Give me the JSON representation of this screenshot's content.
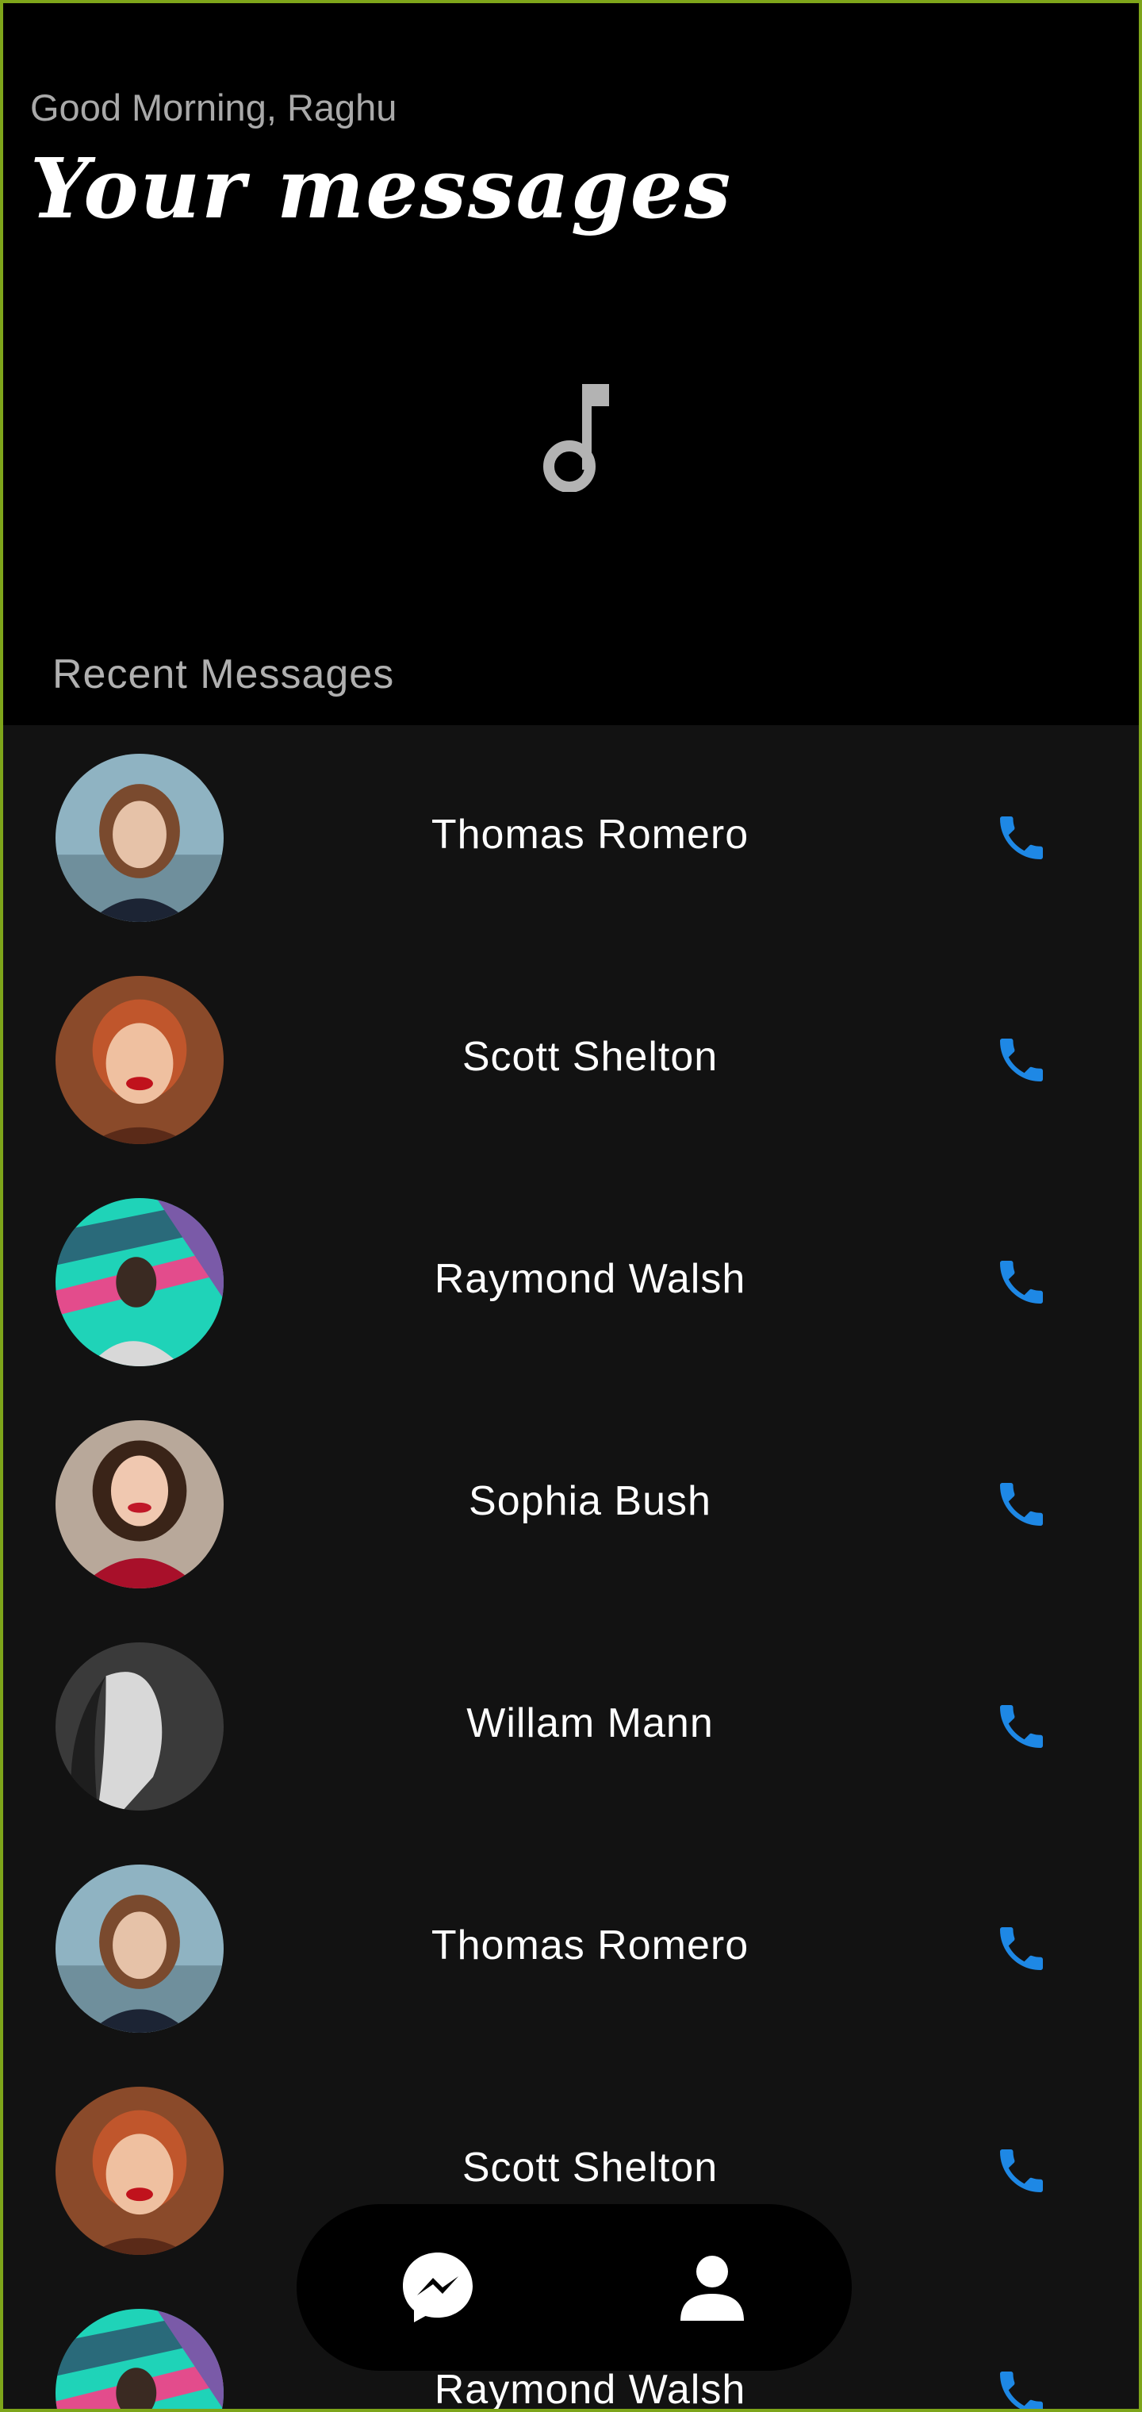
{
  "header": {
    "greeting": "Good Morning, Raghu",
    "title": "Your messages",
    "center_icon": "music-note-icon",
    "section_label": "Recent Messages"
  },
  "colors": {
    "background": "#000000",
    "list_background": "#121212",
    "accent_phone": "#1e88e5",
    "muted_text": "#a9a9a9",
    "frame_border": "#7ea51a"
  },
  "contacts": [
    {
      "name": "Thomas Romero",
      "avatar": "avatar-photo",
      "action_icon": "phone-icon"
    },
    {
      "name": "Scott Shelton",
      "avatar": "avatar-photo",
      "action_icon": "phone-icon"
    },
    {
      "name": "Raymond Walsh",
      "avatar": "avatar-photo",
      "action_icon": "phone-icon"
    },
    {
      "name": "Sophia Bush",
      "avatar": "avatar-photo",
      "action_icon": "phone-icon"
    },
    {
      "name": "Willam Mann",
      "avatar": "avatar-photo",
      "action_icon": "phone-icon"
    },
    {
      "name": "Thomas Romero",
      "avatar": "avatar-photo",
      "action_icon": "phone-icon"
    },
    {
      "name": "Scott Shelton",
      "avatar": "avatar-photo",
      "action_icon": "phone-icon"
    },
    {
      "name": "Raymond Walsh",
      "avatar": "avatar-photo",
      "action_icon": "phone-icon"
    }
  ],
  "bottom_nav": {
    "items": [
      {
        "icon": "messenger-icon"
      },
      {
        "icon": "person-icon"
      }
    ]
  }
}
